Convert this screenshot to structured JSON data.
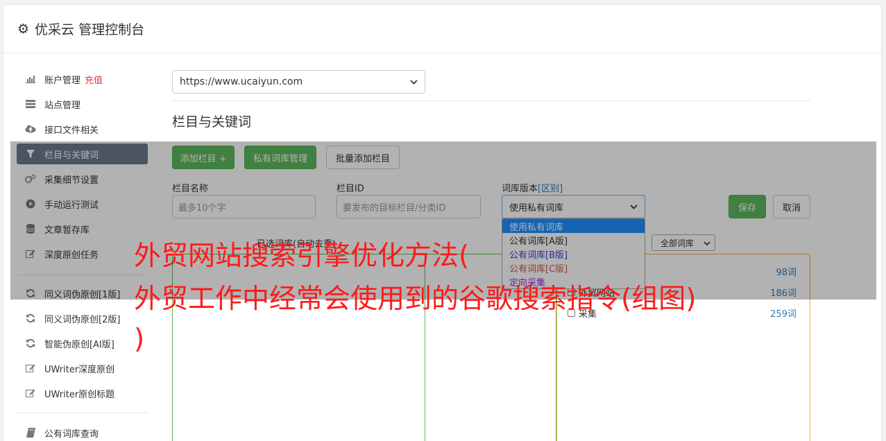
{
  "header": {
    "icon": "gear-icon",
    "title": "优采云 管理控制台"
  },
  "sidebar": {
    "items": [
      {
        "icon": "bar-chart-icon",
        "label": "账户管理",
        "badge": "充值"
      },
      {
        "icon": "server-icon",
        "label": "站点管理"
      },
      {
        "icon": "cloud-upload-icon",
        "label": "接口文件相关"
      },
      {
        "icon": "filter-icon",
        "label": "栏目与关键词",
        "active": true
      },
      {
        "icon": "cogs-icon",
        "label": "采集细节设置"
      },
      {
        "icon": "play-circle-icon",
        "label": "手动运行测试"
      },
      {
        "icon": "database-icon",
        "label": "文章暂存库"
      },
      {
        "icon": "edit-icon",
        "label": "深度原创任务"
      },
      {
        "icon": "refresh-icon",
        "label": "同义词伪原创[1版]"
      },
      {
        "icon": "refresh-icon",
        "label": "同义词伪原创[2版]"
      },
      {
        "icon": "refresh-icon",
        "label": "智能伪原创[AI版]"
      },
      {
        "icon": "edit-icon",
        "label": "UWriter深度原创"
      },
      {
        "icon": "edit-icon",
        "label": "UWriter原创标题"
      },
      {
        "icon": "book-icon",
        "label": "公有词库查询"
      }
    ]
  },
  "main": {
    "site_select": "https://www.ucaiyun.com",
    "section_title": "栏目与关键词",
    "buttons": {
      "add_column": "添加栏目 +",
      "private_lib": "私有词库管理",
      "batch_add": "批量添加栏目",
      "save": "保存",
      "cancel": "取消"
    },
    "form": {
      "column_name_label": "栏目名称",
      "column_name_placeholder": "最多10个字",
      "column_id_label": "栏目ID",
      "column_id_placeholder": "要发布的目标栏目/分类ID",
      "version_label": "词库版本",
      "version_link": "[区别]",
      "version_selected": "使用私有词库"
    },
    "version_options": [
      {
        "label": "使用私有词库",
        "color": "#ffffff"
      },
      {
        "label": "公有词库[A版]",
        "color": "#333333"
      },
      {
        "label": "公有词库[B版]",
        "color": "#3b3bdb"
      },
      {
        "label": "公有词库[C版]",
        "color": "#d9534f"
      },
      {
        "label": "定向采集",
        "color": "#9b30d9"
      }
    ],
    "list_label": "已选词库(自动去重)",
    "wordlib_select": "全部词库",
    "libraries": [
      {
        "name": "",
        "count": "98词"
      },
      {
        "name": "外贸网站",
        "count": "186词"
      },
      {
        "name": "采集",
        "count": "259词"
      }
    ]
  },
  "overlay_text": {
    "line1": "外贸网站搜索引擎优化方法(",
    "line2": "外贸工作中经常会使用到的谷歌搜索指令(组图)",
    "line3": ")"
  }
}
